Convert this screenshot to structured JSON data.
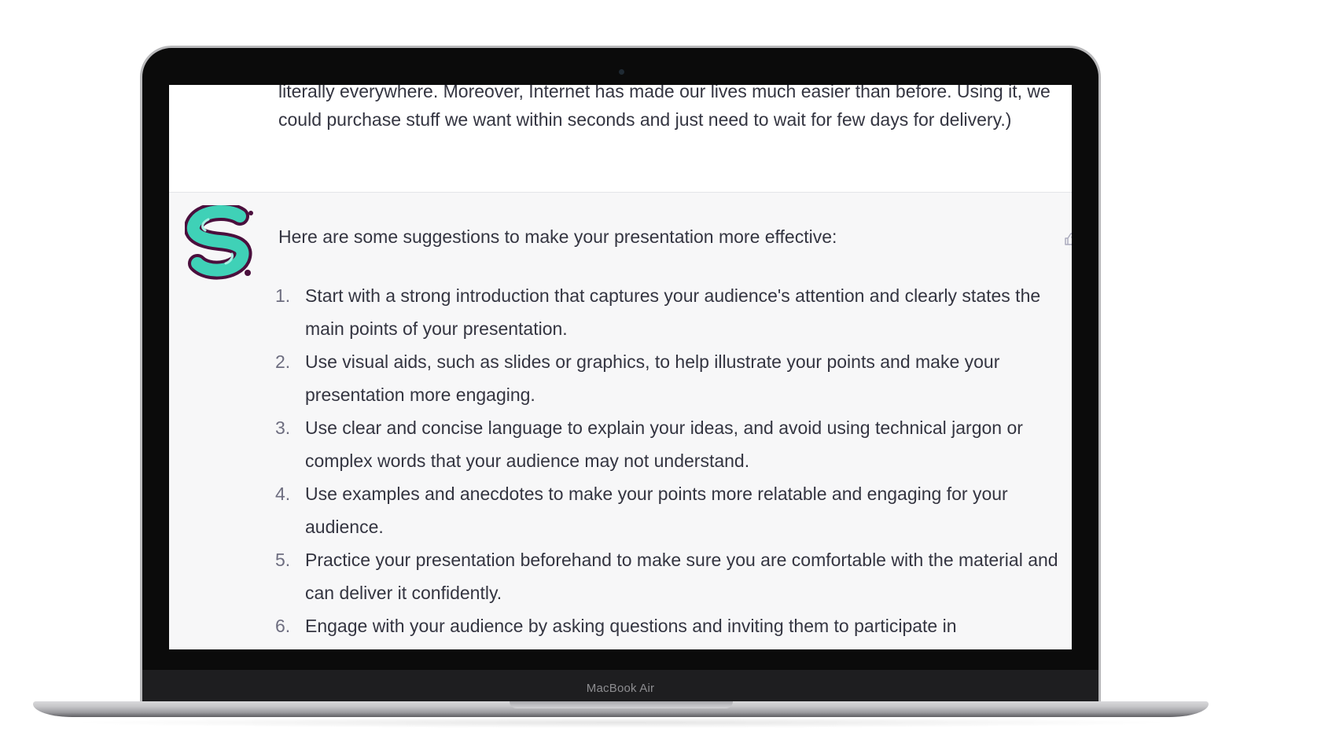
{
  "device": {
    "model_label": "MacBook Air"
  },
  "chat": {
    "previous_message": "literally everywhere. Moreover, Internet has made our lives much easier than before. Using it, we could purchase stuff we want within seconds and just need to wait for few days for delivery.)",
    "reply": {
      "avatar_icon": "s-logo-icon",
      "intro": "Here are some suggestions to make your presentation more effective:",
      "suggestions": [
        {
          "num": "1.",
          "text": "Start with a strong introduction that captures your audience's attention and clearly states the main points of your presentation."
        },
        {
          "num": "2.",
          "text": "Use visual aids, such as slides or graphics, to help illustrate your points and make your presentation more engaging."
        },
        {
          "num": "3.",
          "text": "Use clear and concise language to explain your ideas, and avoid using technical jargon or complex words that your audience may not understand."
        },
        {
          "num": "4.",
          "text": "Use examples and anecdotes to make your points more relatable and engaging for your audience."
        },
        {
          "num": "5.",
          "text": "Practice your presentation beforehand to make sure you are comfortable with the material and can deliver it confidently."
        },
        {
          "num": "6.",
          "text": "Engage with your audience by asking questions and inviting them to participate in"
        }
      ],
      "feedback_icon": "thumbs-up-icon"
    }
  },
  "colors": {
    "text": "#343541",
    "reply_background": "#f7f7f8",
    "avatar_teal": "#3fd1b7",
    "avatar_outline": "#4b0f3d"
  }
}
